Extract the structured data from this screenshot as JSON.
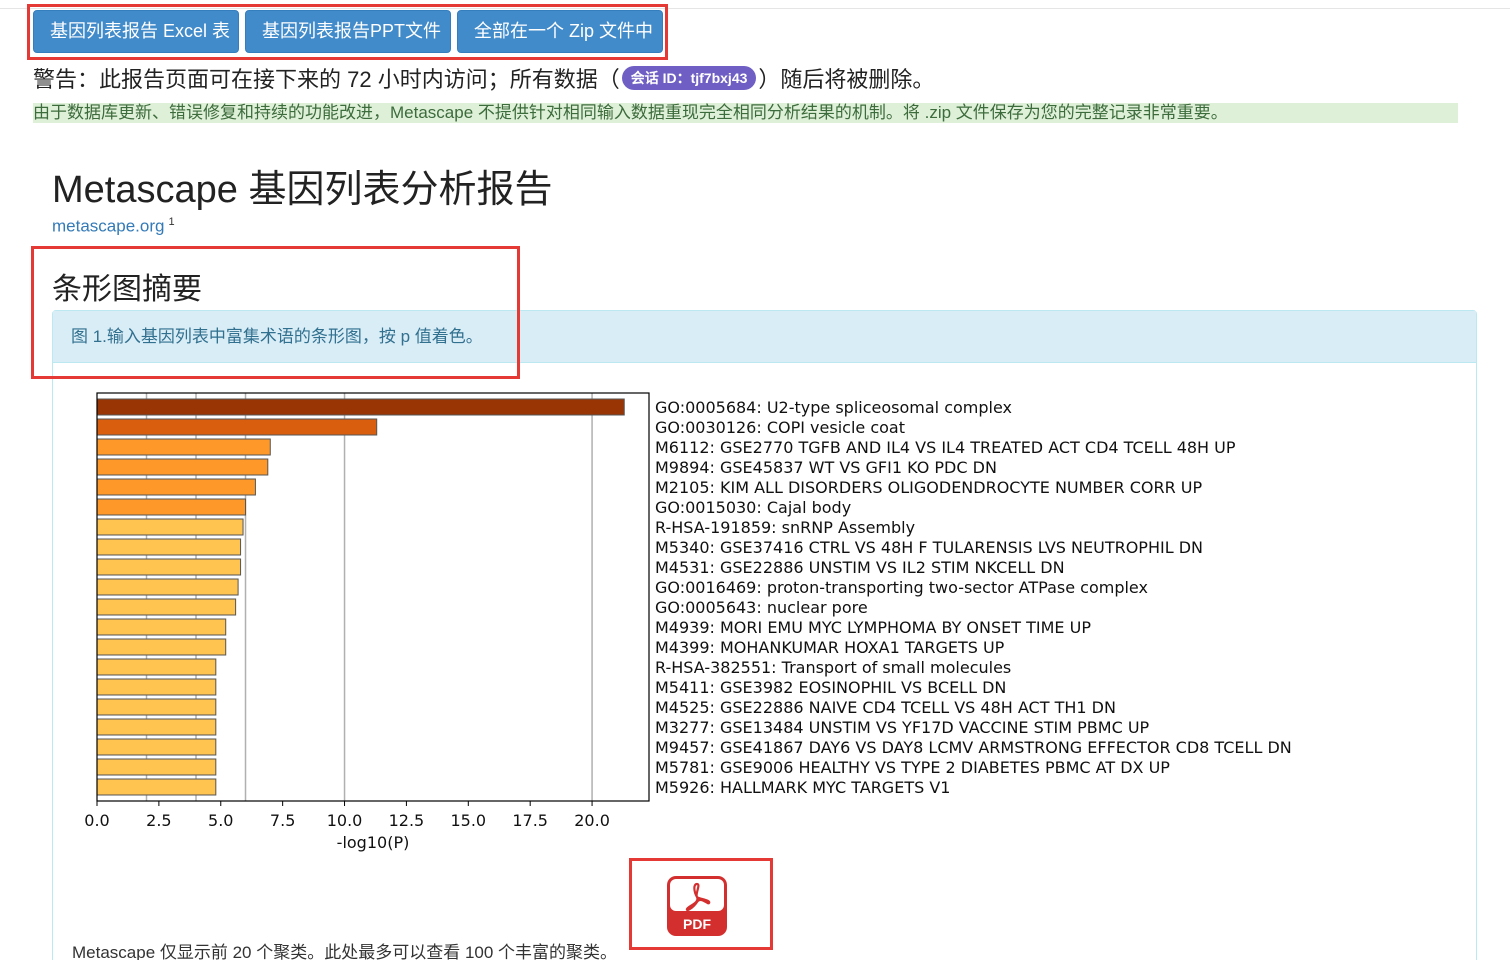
{
  "buttons": {
    "excel": "基因列表报告 Excel 表",
    "ppt": "基因列表报告PPT文件",
    "zip": "全部在一个 Zip 文件中"
  },
  "warning": {
    "prefix": "警告：此报告页面可在接下来的 72 小时内访问；所有数据（",
    "session_badge": "会话 ID：tjf7bxj43",
    "suffix": "）随后将被删除。"
  },
  "note": "由于数据库更新、错误修复和持续的功能改进，Metascape 不提供针对相同输入数据重现完全相同分析结果的机制。将 .zip 文件保存为您的完整记录非常重要。",
  "page_title": "Metascape 基因列表分析报告",
  "site": {
    "link_text": "metascape.org",
    "superscript": "1"
  },
  "section_title": "条形图摘要",
  "figure_caption": "图 1.输入基因列表中富集术语的条形图，按 p 值着色。",
  "footer_note": "Metascape 仅显示前 20 个聚类。此处最多可以查看 100 个丰富的聚类。",
  "pdf_icon": {
    "label": "PDF",
    "color": "#d32f2f"
  },
  "chart_data": {
    "type": "bar",
    "orientation": "horizontal",
    "xlabel": "-log10(P)",
    "xlim": [
      0,
      22.3
    ],
    "xticks": [
      "0.0",
      "2.5",
      "5.0",
      "7.5",
      "10.0",
      "12.5",
      "15.0",
      "17.5",
      "20.0"
    ],
    "grid": "vertical major lines at 2, 4, 6, 10, 20",
    "categories": [
      "GO:0005684: U2-type spliceosomal complex",
      "GO:0030126: COPI vesicle coat",
      "M6112: GSE2770 TGFB AND IL4 VS IL4 TREATED ACT CD4 TCELL 48H UP",
      "M9894: GSE45837 WT VS GFI1 KO PDC DN",
      "M2105: KIM ALL DISORDERS OLIGODENDROCYTE NUMBER CORR UP",
      "GO:0015030: Cajal body",
      "R-HSA-191859: snRNP Assembly",
      "M5340: GSE37416 CTRL VS 48H F TULARENSIS LVS NEUTROPHIL DN",
      "M4531: GSE22886 UNSTIM VS IL2 STIM NKCELL DN",
      "GO:0016469: proton-transporting two-sector ATPase complex",
      "GO:0005643: nuclear pore",
      "M4939: MORI EMU MYC LYMPHOMA BY ONSET TIME UP",
      "M4399: MOHANKUMAR HOXA1 TARGETS UP",
      "R-HSA-382551: Transport of small molecules",
      "M5411: GSE3982 EOSINOPHIL VS BCELL DN",
      "M4525: GSE22886 NAIVE CD4 TCELL VS 48H ACT TH1 DN",
      "M3277: GSE13484 UNSTIM VS YF17D VACCINE STIM PBMC UP",
      "M9457: GSE41867 DAY6 VS DAY8 LCMV ARMSTRONG EFFECTOR CD8 TCELL DN",
      "M5781: GSE9006 HEALTHY VS TYPE 2 DIABETES PBMC AT DX UP",
      "M5926: HALLMARK MYC TARGETS V1"
    ],
    "values": [
      21.3,
      11.3,
      7.0,
      6.9,
      6.4,
      6.0,
      5.9,
      5.8,
      5.8,
      5.7,
      5.6,
      5.2,
      5.2,
      4.8,
      4.8,
      4.8,
      4.8,
      4.8,
      4.8,
      4.8
    ],
    "colors": [
      "#993404",
      "#d95f0e",
      "#fe9929",
      "#fe9929",
      "#fe9929",
      "#fe9929",
      "#fec44f",
      "#fec44f",
      "#fec44f",
      "#fec44f",
      "#fec44f",
      "#fec44f",
      "#fec44f",
      "#fec44f",
      "#fec44f",
      "#fec44f",
      "#fec44f",
      "#fec44f",
      "#fec44f",
      "#fec44f"
    ]
  }
}
